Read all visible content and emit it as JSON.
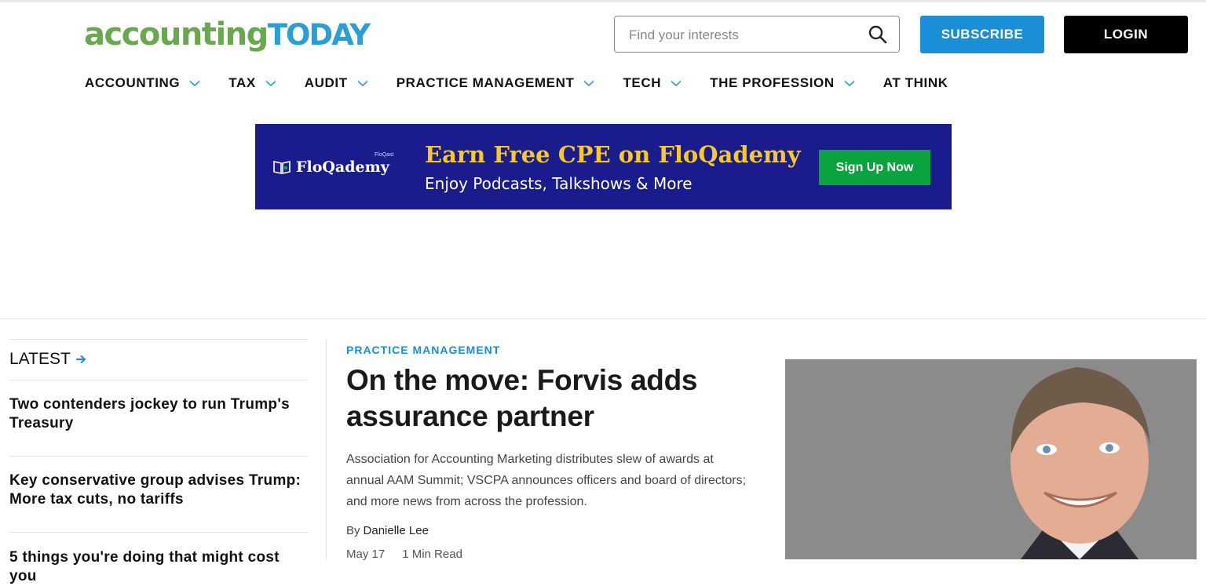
{
  "header": {
    "logo_part1": "accounting",
    "logo_part2": "TODAY",
    "search_placeholder": "Find your interests",
    "subscribe_label": "SUBSCRIBE",
    "login_label": "LOGIN"
  },
  "nav": {
    "items": [
      {
        "label": "ACCOUNTING"
      },
      {
        "label": "TAX"
      },
      {
        "label": "AUDIT"
      },
      {
        "label": "PRACTICE MANAGEMENT"
      },
      {
        "label": "TECH"
      },
      {
        "label": "THE PROFESSION"
      },
      {
        "label": "AT THINK"
      }
    ]
  },
  "ad": {
    "brand": "FloQademy",
    "tiny_brand": "FloQast",
    "headline": "Earn Free CPE on FloQademy",
    "subline": "Enjoy Podcasts, Talkshows & More",
    "cta": "Sign Up Now"
  },
  "sidebar": {
    "latest_label": "LATEST",
    "stories": [
      {
        "title": "Two contenders jockey to run Trump's Treasury"
      },
      {
        "title": "Key conservative group advises Trump: More tax cuts, no tariffs"
      },
      {
        "title": "5 things you're doing that might cost you"
      }
    ]
  },
  "main": {
    "kicker": "PRACTICE MANAGEMENT",
    "title": "On the move: Forvis adds assurance partner",
    "description": "Association for Accounting Marketing distributes slew of awards at annual AAM Summit; VSCPA announces officers and board of directors; and more news from across the profession.",
    "by_label": "By",
    "author": "Danielle Lee",
    "date": "May 17",
    "read_time": "1 Min Read"
  },
  "colors": {
    "logo_green": "#6aa84f",
    "logo_blue": "#2a9fd6",
    "accent_blue": "#1a8ed6",
    "ad_background": "#1a1c8e",
    "ad_headline": "#f6c928",
    "ad_cta": "#0aa33f"
  }
}
